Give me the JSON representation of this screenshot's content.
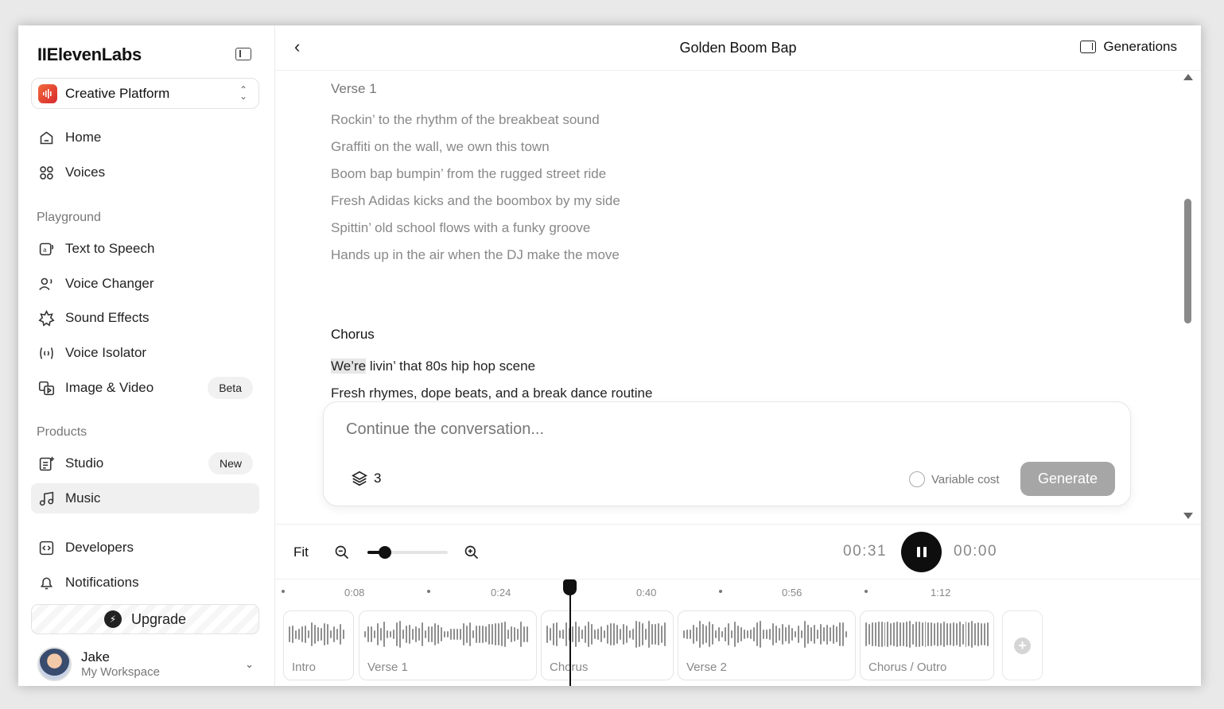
{
  "sidebar": {
    "logo": "IIElevenLabs",
    "platform": "Creative Platform",
    "nav_top": [
      {
        "label": "Home"
      },
      {
        "label": "Voices"
      }
    ],
    "section_playground": "Playground",
    "playground": [
      {
        "label": "Text to Speech"
      },
      {
        "label": "Voice Changer"
      },
      {
        "label": "Sound Effects"
      },
      {
        "label": "Voice Isolator"
      },
      {
        "label": "Image & Video",
        "badge": "Beta"
      }
    ],
    "section_products": "Products",
    "products": [
      {
        "label": "Studio",
        "badge": "New"
      },
      {
        "label": "Music",
        "active": true
      }
    ],
    "bottom": [
      {
        "label": "Developers"
      },
      {
        "label": "Notifications"
      }
    ],
    "upgrade": "Upgrade",
    "user": {
      "name": "Jake",
      "workspace": "My Workspace"
    }
  },
  "header": {
    "title": "Golden Boom Bap",
    "generations": "Generations"
  },
  "lyrics": {
    "verse1_title": "Verse 1",
    "verse1": [
      "Rockin’ to the rhythm of the breakbeat sound",
      "Graffiti on the wall, we own this town",
      "Boom bap bumpin’ from the rugged street ride",
      "Fresh Adidas kicks and the boombox by my side",
      "Spittin’ old school flows with a funky groove",
      "Hands up in the air when the DJ make the move"
    ],
    "chorus_title": "Chorus",
    "chorus_highlight": "We’re",
    "chorus_line1_rest": " livin’ that 80s hip hop scene",
    "chorus_line2": "Fresh rhymes, dope beats, and a break dance routine"
  },
  "composer": {
    "placeholder": "Continue the conversation...",
    "count": "3",
    "variable_cost": "Variable cost",
    "generate": "Generate"
  },
  "controls": {
    "fit": "Fit",
    "zoom_level": 0.22,
    "current_time": "00:31",
    "total_time": "00:00"
  },
  "timeline": {
    "ticks": [
      "0:08",
      "0:24",
      "0:40",
      "0:56",
      "1:12"
    ],
    "segments": [
      "Intro",
      "Verse 1",
      "Chorus",
      "Verse 2",
      "Chorus / Outro"
    ]
  },
  "colors": {
    "accent": "#111111",
    "generate_disabled": "#a6a6a6",
    "logo_gradient": "#e0452f"
  }
}
